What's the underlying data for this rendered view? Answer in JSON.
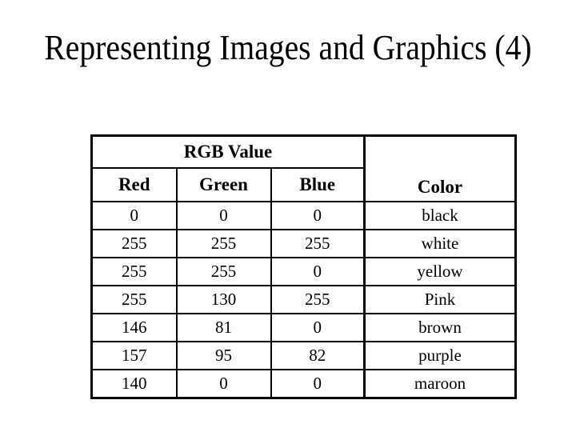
{
  "slide": {
    "title": "Representing Images and Graphics (4)"
  },
  "table": {
    "group_header": "RGB Value",
    "headers": {
      "red": "Red",
      "green": "Green",
      "blue": "Blue",
      "color": "Color"
    },
    "rows": [
      {
        "red": "0",
        "green": "0",
        "blue": "0",
        "color": "black"
      },
      {
        "red": "255",
        "green": "255",
        "blue": "255",
        "color": "white"
      },
      {
        "red": "255",
        "green": "255",
        "blue": "0",
        "color": "yellow"
      },
      {
        "red": "255",
        "green": "130",
        "blue": "255",
        "color": "Pink"
      },
      {
        "red": "146",
        "green": "81",
        "blue": "0",
        "color": "brown"
      },
      {
        "red": "157",
        "green": "95",
        "blue": "82",
        "color": "purple"
      },
      {
        "red": "140",
        "green": "0",
        "blue": "0",
        "color": "maroon"
      }
    ]
  }
}
